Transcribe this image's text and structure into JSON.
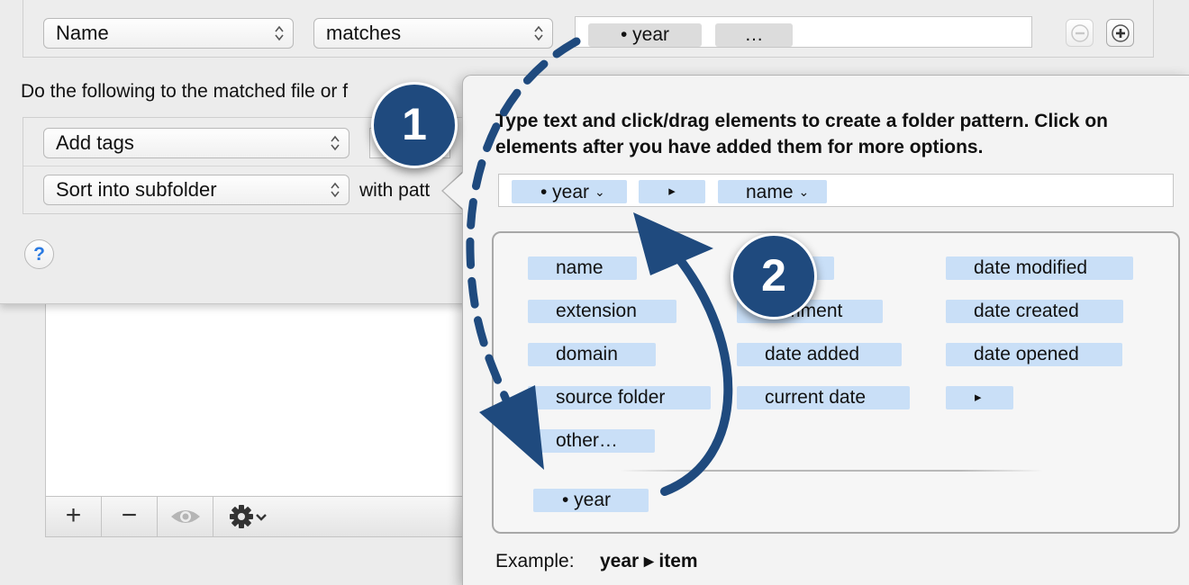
{
  "rule": {
    "attribute": "Name",
    "operator": "matches",
    "tokens": [
      "• year",
      "…"
    ]
  },
  "actions_sentence": "Do the following to the matched file or f",
  "actions": [
    {
      "label": "Add tags"
    },
    {
      "label": "Sort into subfolder",
      "suffix": "with patt"
    }
  ],
  "help_label": "?",
  "toolbar": {
    "add_label": "+",
    "remove_label": "−"
  },
  "popover": {
    "instructions": "Type text and click/drag elements to create a folder pattern. Click on elements after you have added them for more options.",
    "pattern_tokens": [
      {
        "label": "• year",
        "menu": true
      },
      {
        "label": "▸",
        "menu": false
      },
      {
        "label": "name",
        "menu": true
      }
    ],
    "palette": {
      "col1": [
        "name",
        "extension",
        "domain",
        "source folder",
        "other…"
      ],
      "col2": [
        "",
        "comment",
        "date added",
        "current date"
      ],
      "col3": [
        "date modified",
        "date created",
        "date opened",
        "▸"
      ],
      "dragged": "• year"
    },
    "example_label": "Example:",
    "example_value": "year ▸ item"
  },
  "callouts": [
    "1",
    "2"
  ],
  "colors": {
    "token_blue": "#c9dff7",
    "callout": "#1f4a7e",
    "help_blue": "#2a7ae2"
  }
}
